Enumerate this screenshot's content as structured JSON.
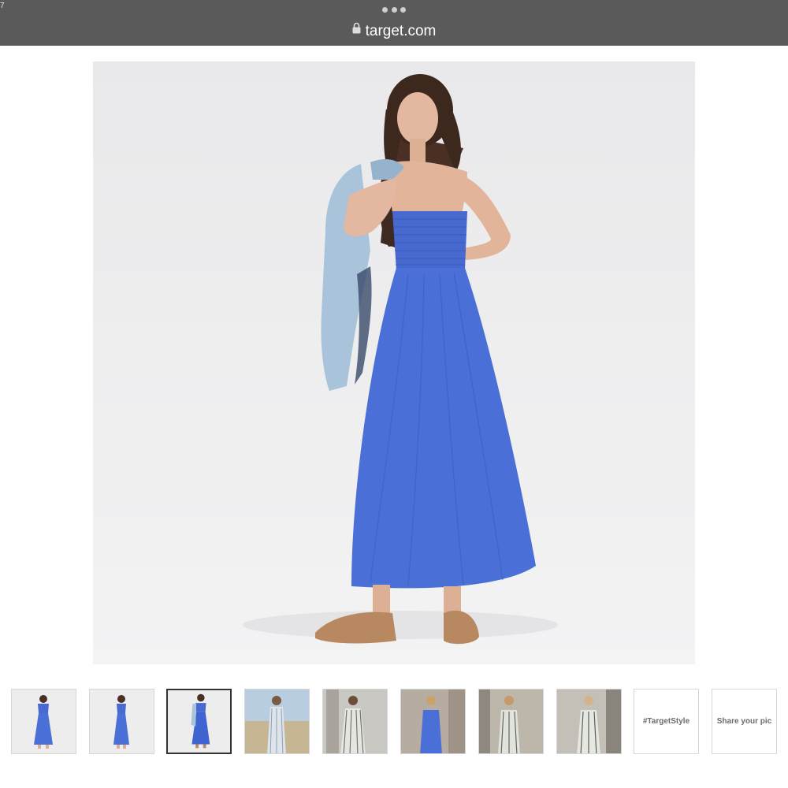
{
  "browser": {
    "corner_text": "7",
    "url": "target.com",
    "lock_icon": "lock-icon",
    "menu_icon": "ellipsis-icon"
  },
  "product": {
    "main_image_alt": "Woman wearing a blue strapless smocked maxi dress holding a denim jacket",
    "colors": {
      "dress": "#4a6fd6",
      "background": "#ececee"
    }
  },
  "thumbnails": [
    {
      "type": "image",
      "selected": false
    },
    {
      "type": "image",
      "selected": false
    },
    {
      "type": "image",
      "selected": true
    },
    {
      "type": "image",
      "selected": false
    },
    {
      "type": "image",
      "selected": false
    },
    {
      "type": "image",
      "selected": false
    },
    {
      "type": "image",
      "selected": false
    },
    {
      "type": "image",
      "selected": false
    },
    {
      "type": "text",
      "label": "#TargetStyle"
    },
    {
      "type": "text",
      "label": "Share your pic"
    }
  ]
}
